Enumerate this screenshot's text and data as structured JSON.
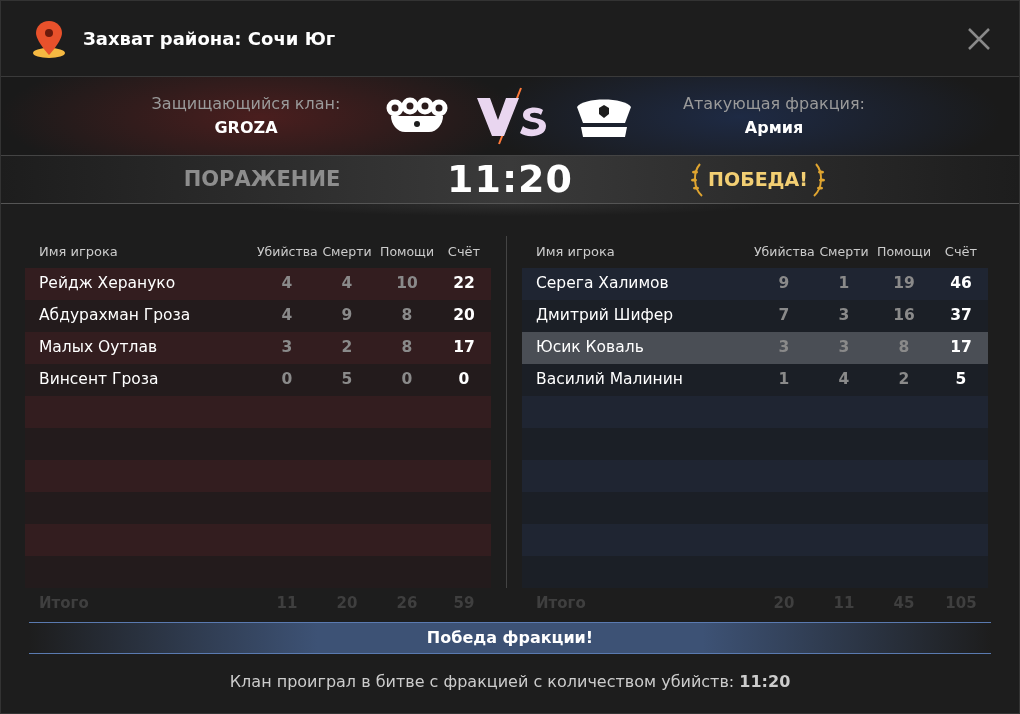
{
  "window": {
    "title": "Захват района: Сочи Юг"
  },
  "versus": {
    "defender_label": "Защищающийся клан:",
    "defender_name": "GROZA",
    "attacker_label": "Атакующая фракция:",
    "attacker_name": "Армия"
  },
  "result": {
    "left": "ПОРАЖЕНИЕ",
    "score": "11:20",
    "right": "ПОБЕДА!"
  },
  "tables": [
    {
      "kind": "defender",
      "columns": [
        "Имя игрока",
        "Убийства",
        "Смерти",
        "Помощи",
        "Счёт"
      ],
      "rows": [
        {
          "name": "Рейдж Херануко",
          "kills": "4",
          "deaths": "4",
          "assists": "10",
          "score": "22",
          "selected": false
        },
        {
          "name": "Абдурахман Гроза",
          "kills": "4",
          "deaths": "9",
          "assists": "8",
          "score": "20",
          "selected": false
        },
        {
          "name": "Малых Оутлав",
          "kills": "3",
          "deaths": "2",
          "assists": "8",
          "score": "17",
          "selected": false
        },
        {
          "name": "Винсент Гроза",
          "kills": "0",
          "deaths": "5",
          "assists": "0",
          "score": "0",
          "selected": false
        }
      ],
      "totals": {
        "label": "Итого",
        "kills": "11",
        "deaths": "20",
        "assists": "26",
        "score": "59"
      }
    },
    {
      "kind": "attacker",
      "columns": [
        "Имя игрока",
        "Убийства",
        "Смерти",
        "Помощи",
        "Счёт"
      ],
      "rows": [
        {
          "name": "Серега Халимов",
          "kills": "9",
          "deaths": "1",
          "assists": "19",
          "score": "46",
          "selected": false
        },
        {
          "name": "Дмитрий Шифер",
          "kills": "7",
          "deaths": "3",
          "assists": "16",
          "score": "37",
          "selected": false
        },
        {
          "name": "Юсик Коваль",
          "kills": "3",
          "deaths": "3",
          "assists": "8",
          "score": "17",
          "selected": true
        },
        {
          "name": "Василий Малинин",
          "kills": "1",
          "deaths": "4",
          "assists": "2",
          "score": "5",
          "selected": false
        }
      ],
      "totals": {
        "label": "Итого",
        "kills": "20",
        "deaths": "11",
        "assists": "45",
        "score": "105"
      }
    }
  ],
  "banner": "Победа фракции!",
  "footer": "Клан проиграл в битве с фракцией с количеством убийств: **11:20**"
}
